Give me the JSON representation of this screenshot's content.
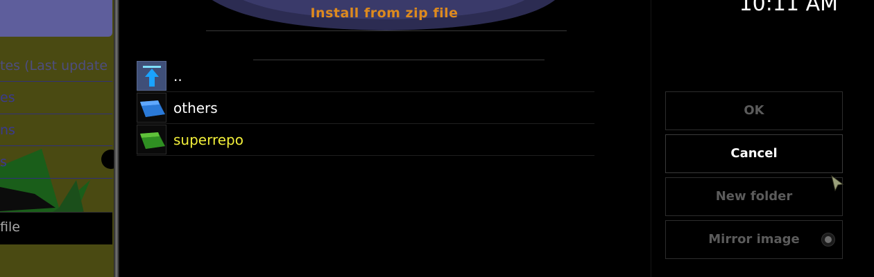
{
  "background": {
    "items": [
      "tes (Last update",
      "es",
      "ns",
      "s"
    ],
    "footer_label": "file"
  },
  "dialog": {
    "title": "Install from zip file",
    "files": [
      {
        "name": "..",
        "icon": "parent-folder-icon"
      },
      {
        "name": "others",
        "icon": "folder-icon"
      },
      {
        "name": "superrepo",
        "icon": "folder-icon"
      }
    ]
  },
  "clock": "10:11 AM",
  "buttons": {
    "ok": "OK",
    "cancel": "Cancel",
    "new_folder": "New folder",
    "mirror_image": "Mirror image"
  },
  "colors": {
    "title": "#dd8a1e",
    "focused_item": "#f2ef3a",
    "disabled_button": "#5b5b5b"
  }
}
